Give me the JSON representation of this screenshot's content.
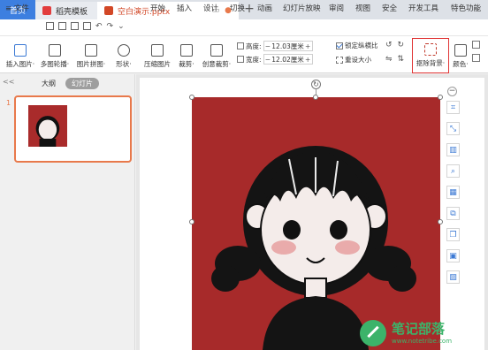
{
  "tabs": {
    "home": "首页",
    "template": "稻壳模板",
    "document": "空白演示.pptx",
    "new_tab": "+"
  },
  "menu": {
    "file": "≡ 文件",
    "items": [
      "开始",
      "插入",
      "设计",
      "切换",
      "动画",
      "幻灯片放映",
      "审阅",
      "视图",
      "安全",
      "开发工具",
      "特色功能"
    ]
  },
  "ribbon": {
    "insert_picture": "插入图片·",
    "multi_outline": "多图轮播·",
    "picture_collage": "图片拼图·",
    "shape": "形状·",
    "compress_picture": "压缩图片",
    "crop": "裁剪·",
    "creative_crop": "创意裁剪·",
    "height_label": "高度:",
    "height_value": "12.03厘米",
    "width_label": "宽度:",
    "width_value": "12.02厘米",
    "lock_ratio": "锁定纵横比",
    "reset_size": "重设大小",
    "remove_background": "抠除背景·",
    "color": "颜色·"
  },
  "left_pane": {
    "outline_tab": "大纲",
    "slides_tab": "幻灯片",
    "slide_number": "1",
    "collapse": "<<"
  },
  "watermark": {
    "text": "笔记部落",
    "url": "www.notetribe.com"
  },
  "colors": {
    "accent": "#3d7fe0",
    "picture_bg": "#a72a2a",
    "highlight": "#e03434",
    "slide_border": "#e8794b",
    "watermark_green": "#3cb36a"
  }
}
